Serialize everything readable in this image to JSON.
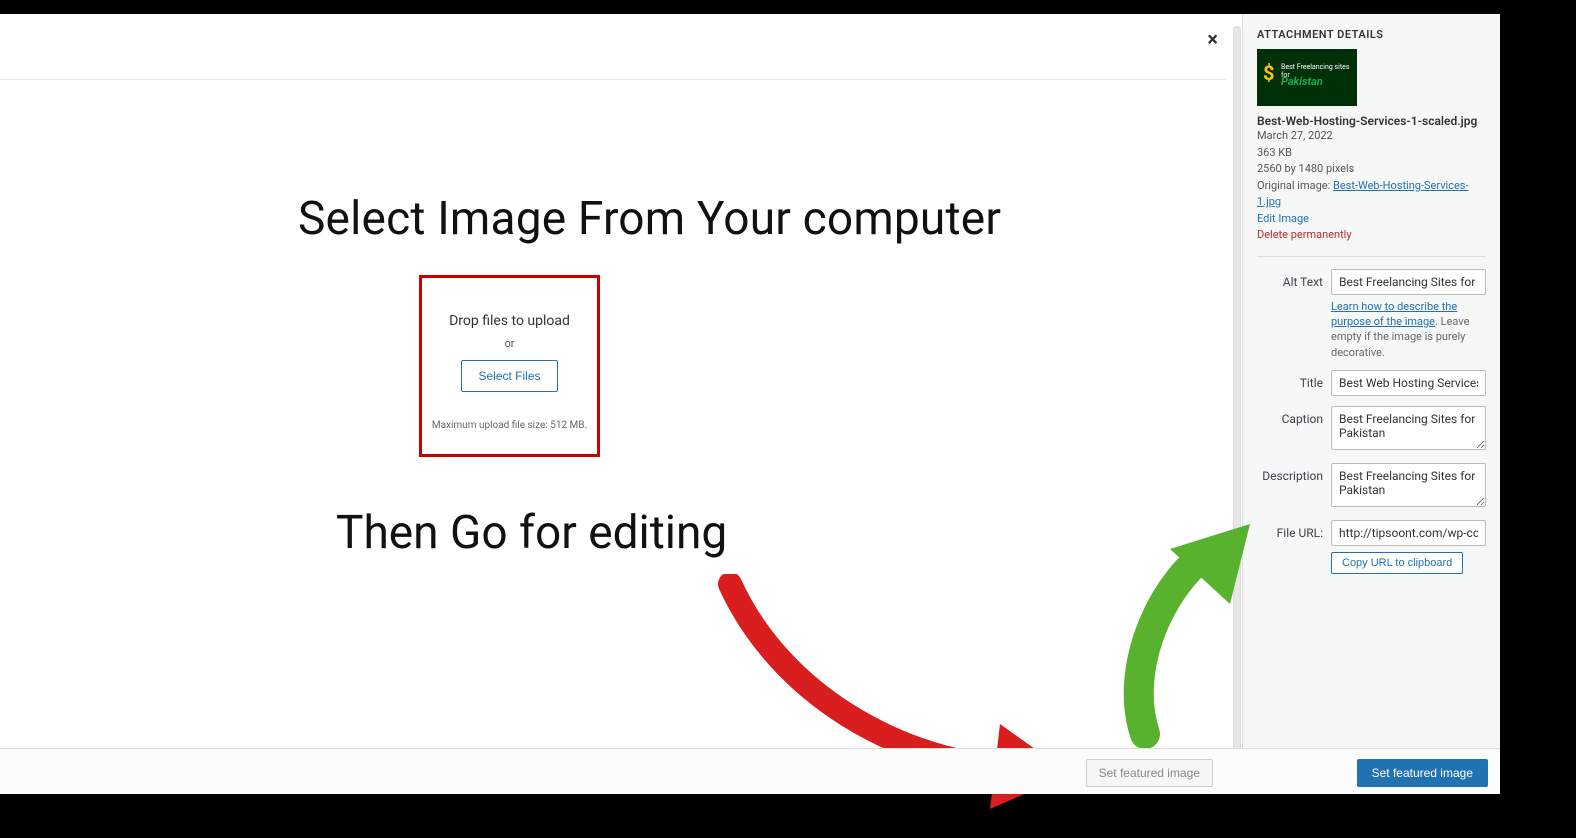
{
  "main": {
    "close_icon": "×",
    "heading_1": "Select Image From Your computer",
    "heading_2": "Then Go for editing",
    "upload_box": {
      "drop_text": "Drop files to upload",
      "or": "or",
      "select_files": "Select Files",
      "max_text": "Maximum upload file size: 512 MB."
    }
  },
  "sidebar": {
    "title": "ATTACHMENT DETAILS",
    "thumb": {
      "dollar": "$",
      "line1": "Best Freelancing sites for",
      "line2": "Pakistan"
    },
    "filename": "Best-Web-Hosting-Services-1-scaled.jpg",
    "date": "March 27, 2022",
    "size": "363 KB",
    "dims": "2560 by 1480 pixels",
    "orig_label": "Original image: ",
    "orig_link": "Best-Web-Hosting-Services-1.jpg",
    "edit_image": "Edit Image",
    "delete_perm": "Delete permanently",
    "fields": {
      "alt_label": "Alt Text",
      "alt_value": "Best Freelancing Sites for Pakistan",
      "alt_help_link": "Learn how to describe the purpose of the image",
      "alt_help_rest": ". Leave empty if the image is purely decorative.",
      "title_label": "Title",
      "title_value": "Best Web Hosting Services",
      "caption_label": "Caption",
      "caption_value": "Best Freelancing Sites for Pakistan",
      "desc_label": "Description",
      "desc_value": "Best Freelancing Sites for Pakistan",
      "url_label": "File URL:",
      "url_value": "http://tipsoont.com/wp-content/",
      "copy_btn": "Copy URL to clipboard"
    }
  },
  "footer": {
    "set_featured_disabled": "Set featured image",
    "set_featured_primary": "Set featured image"
  }
}
